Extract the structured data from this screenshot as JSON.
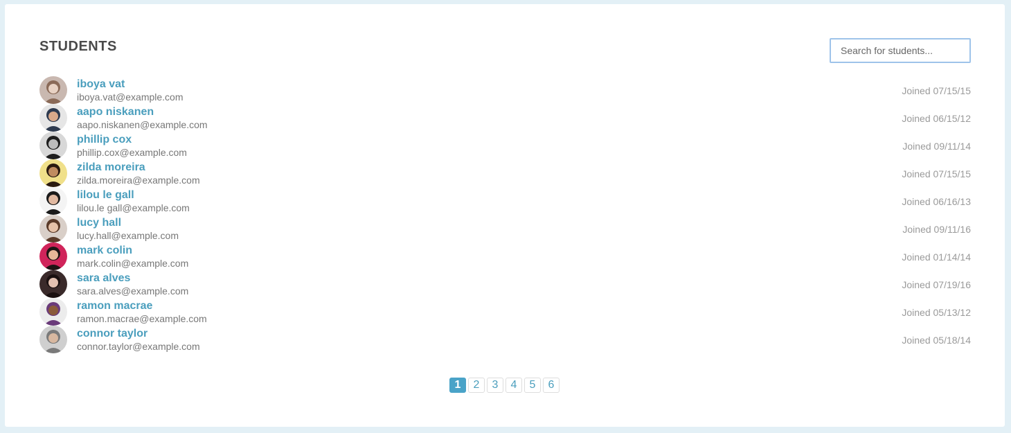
{
  "header": {
    "title": "STUDENTS"
  },
  "search": {
    "placeholder": "Search for students...",
    "value": ""
  },
  "colors": {
    "background": "#e3f0f6",
    "card": "#ffffff",
    "name_link": "#4a9ebd",
    "active_page": "#4aa3c8",
    "search_border": "#9ec3ea"
  },
  "students": [
    {
      "name": "iboya vat",
      "email": "iboya.vat@example.com",
      "joined": "Joined 07/15/15",
      "avatar_colors": [
        "#c9b8b0",
        "#8a6a58",
        "#e8d2c4"
      ]
    },
    {
      "name": "aapo niskanen",
      "email": "aapo.niskanen@example.com",
      "joined": "Joined 06/15/12",
      "avatar_colors": [
        "#e6e6e6",
        "#2d3a4f",
        "#d9a98a"
      ]
    },
    {
      "name": "phillip cox",
      "email": "phillip.cox@example.com",
      "joined": "Joined 09/11/14",
      "avatar_colors": [
        "#d8d8d8",
        "#1e1e1e",
        "#bdbdbd"
      ]
    },
    {
      "name": "zilda moreira",
      "email": "zilda.moreira@example.com",
      "joined": "Joined 07/15/15",
      "avatar_colors": [
        "#f0e08a",
        "#2a1a10",
        "#c08c60"
      ]
    },
    {
      "name": "lilou le gall",
      "email": "lilou.le gall@example.com",
      "joined": "Joined 06/16/13",
      "avatar_colors": [
        "#f4f4f4",
        "#1a1a1a",
        "#e0b8a0"
      ]
    },
    {
      "name": "lucy hall",
      "email": "lucy.hall@example.com",
      "joined": "Joined 09/11/16",
      "avatar_colors": [
        "#d9cfc8",
        "#5a3a28",
        "#e6c2a8"
      ]
    },
    {
      "name": "mark colin",
      "email": "mark.colin@example.com",
      "joined": "Joined 01/14/14",
      "avatar_colors": [
        "#d0245a",
        "#1e1414",
        "#e8b898"
      ]
    },
    {
      "name": "sara alves",
      "email": "sara.alves@example.com",
      "joined": "Joined 07/19/16",
      "avatar_colors": [
        "#3a2a2a",
        "#1a1010",
        "#e2c0b0"
      ]
    },
    {
      "name": "ramon macrae",
      "email": "ramon.macrae@example.com",
      "joined": "Joined 05/13/12",
      "avatar_colors": [
        "#ececec",
        "#6a3a7a",
        "#8a5a3a"
      ]
    },
    {
      "name": "connor taylor",
      "email": "connor.taylor@example.com",
      "joined": "Joined 05/18/14",
      "avatar_colors": [
        "#cfcfcf",
        "#7a7a7a",
        "#d8b8a0"
      ]
    }
  ],
  "pagination": {
    "pages": [
      "1",
      "2",
      "3",
      "4",
      "5",
      "6"
    ],
    "active": "1"
  }
}
